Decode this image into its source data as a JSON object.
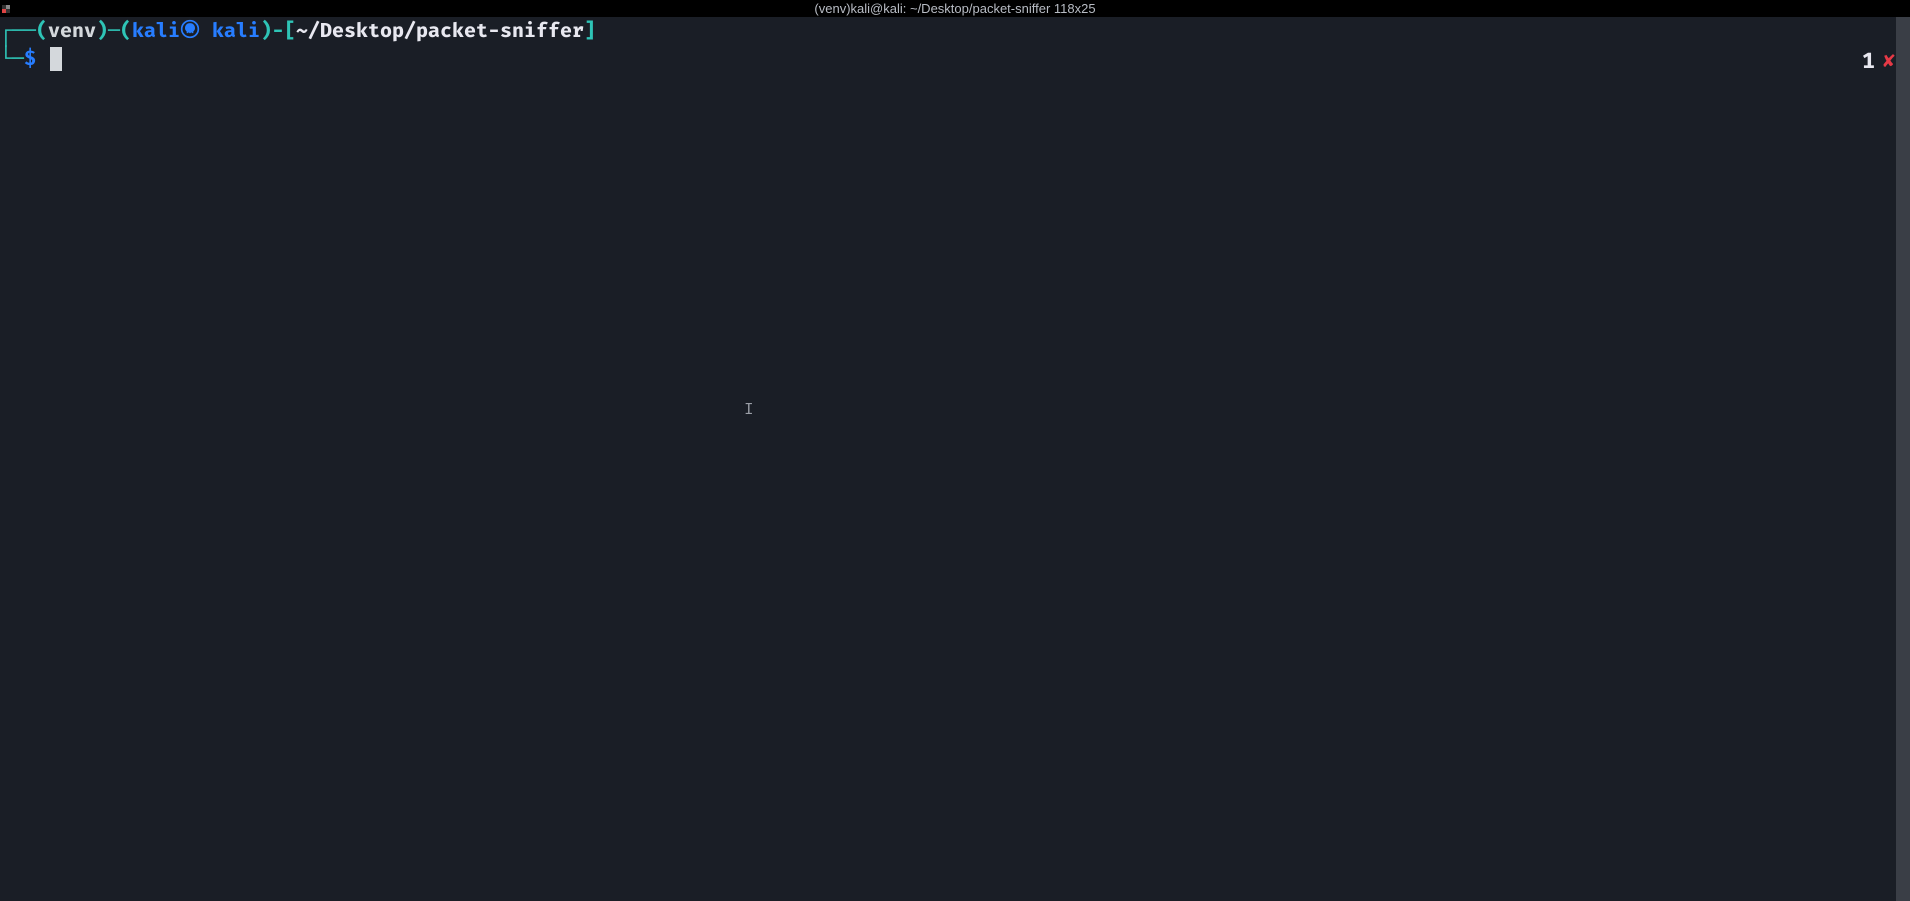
{
  "titlebar": {
    "title": "(venv)kali@kali: ~/Desktop/packet-sniffer 118x25"
  },
  "prompt": {
    "box_tl": "┌──",
    "box_bl": "└─",
    "paren_open": "(",
    "paren_close": ")",
    "venv": "venv",
    "dash": "─",
    "user": "kali",
    "host": "kali",
    "bracket_open": "[",
    "bracket_close": "]",
    "path": "~/Desktop/packet-sniffer",
    "symbol": "$",
    "dash2": "-"
  },
  "status": {
    "number": "1",
    "x": "✘"
  },
  "icons": {
    "skull": "skull-icon",
    "text_cursor": "I"
  },
  "colors": {
    "bg": "#1a1e26",
    "teal": "#2ec4b6",
    "blue": "#277dff",
    "white": "#e8e8f0",
    "light": "#d4d8dc",
    "red": "#e63946"
  }
}
